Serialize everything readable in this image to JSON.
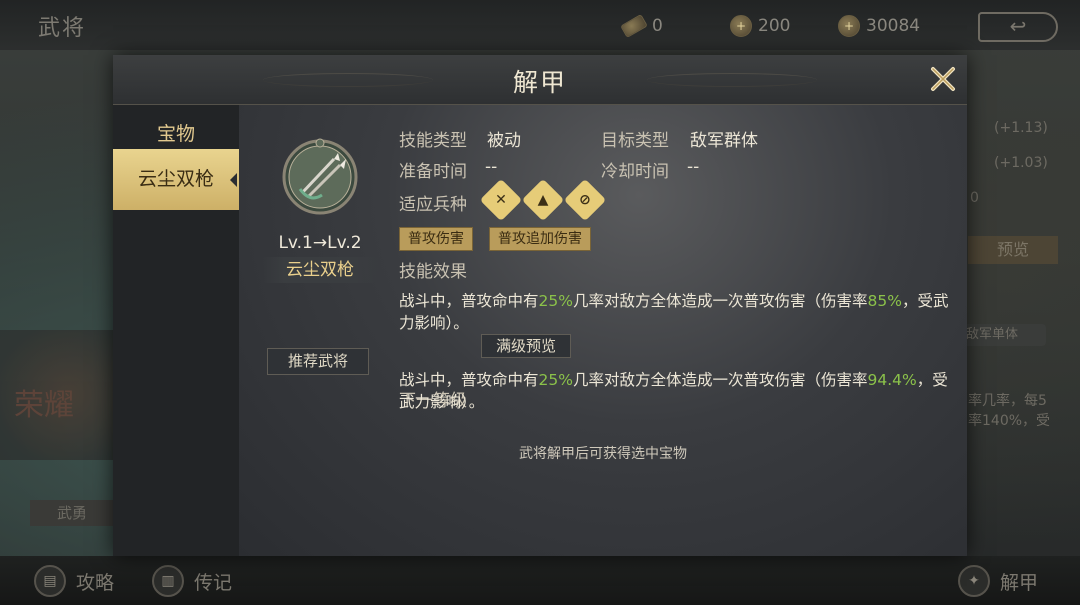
{
  "background": {
    "page_title": "武将",
    "resources": [
      {
        "icon": "scroll-token-icon",
        "value": "0"
      },
      {
        "icon": "gold-coin-icon",
        "value": "200"
      },
      {
        "icon": "silver-coin-icon",
        "value": "30084"
      }
    ],
    "right_stats": [
      "(+1.13)",
      "(+1.03)",
      "0"
    ],
    "preview_label": "预览",
    "target_badge": "敌军单体",
    "right_desc_1": "率几率，每5",
    "right_desc_2": "率140%，受",
    "left_banner_text": "荣耀",
    "left_tag": "武勇"
  },
  "bottom_bar": {
    "guide_label": "攻略",
    "biography_label": "传记",
    "disarm_label": "解甲"
  },
  "modal": {
    "title": "解甲",
    "sidebar": {
      "category": "宝物",
      "items": [
        {
          "label": "云尘双枪"
        }
      ]
    },
    "item": {
      "level_text": "Lv.1→Lv.2",
      "name": "云尘双枪",
      "recommend_label": "推荐武将"
    },
    "skill": {
      "type_label": "技能类型",
      "type_value": "被动",
      "target_label": "目标类型",
      "target_value": "敌军群体",
      "prep_label": "准备时间",
      "prep_value": "--",
      "cooldown_label": "冷却时间",
      "cooldown_value": "--",
      "unit_label": "适应兵种",
      "tags": [
        "普攻伤害",
        "普攻追加伤害"
      ],
      "effect_label": "技能效果",
      "effect_current": {
        "part1": "战斗中，普攻命中有",
        "chance": "25%",
        "part2": "几率对敌方全体造成一次普攻伤害（伤害率",
        "rate": "85%",
        "part3": "，受武力影响）。"
      },
      "next_label": "下一等级",
      "max_preview_label": "满级预览",
      "effect_next": {
        "part1": "战斗中，普攻命中有",
        "chance": "25%",
        "part2": "几率对敌方全体造成一次普攻伤害（伤害率",
        "rate": "94.4%",
        "part3": "，受武力影响）。"
      }
    },
    "footer_note": "武将解甲后可获得选中宝物"
  }
}
